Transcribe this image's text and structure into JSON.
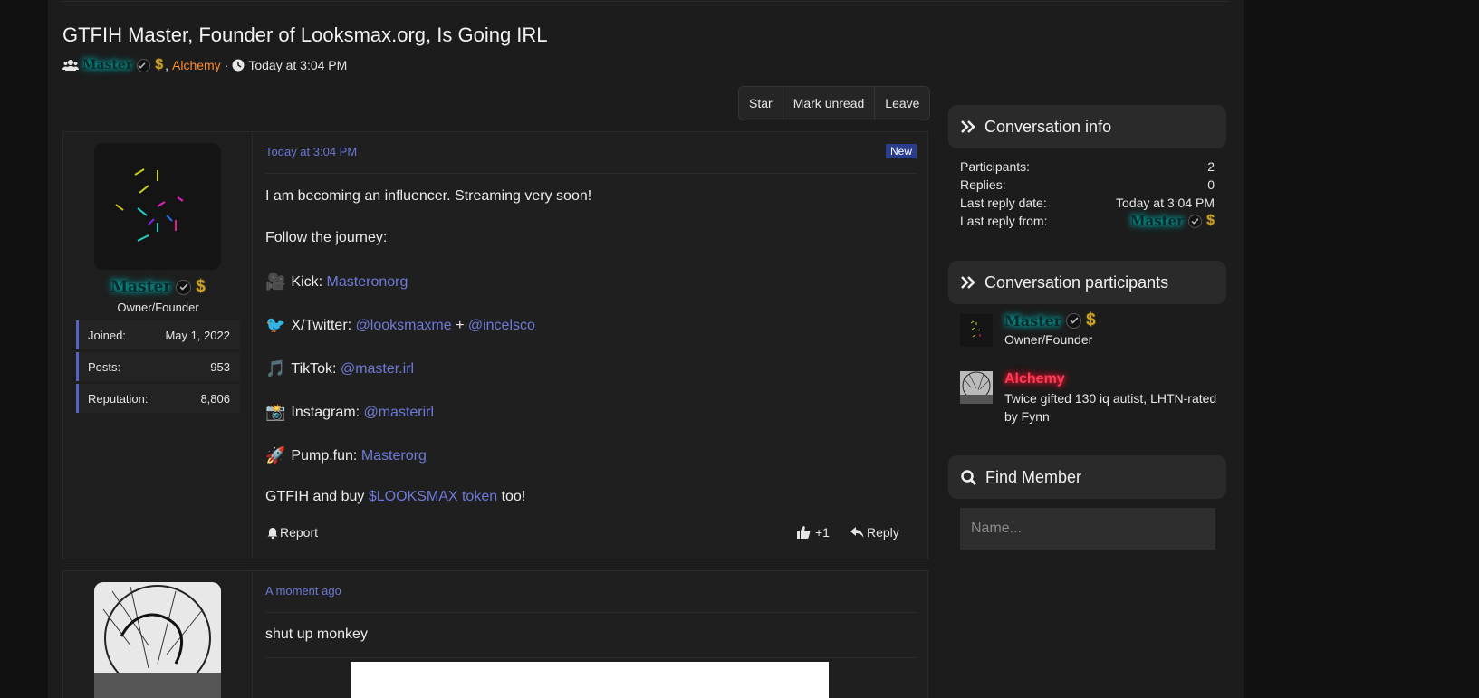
{
  "thread": {
    "title": "GTFIH Master, Founder of Looksmax.org, Is Going IRL",
    "participant_1": "Master",
    "separator": ",",
    "participant_2": "Alchemy",
    "dot": "·",
    "time": "Today at 3:04 PM"
  },
  "actions": {
    "star": "Star",
    "mark_unread": "Mark unread",
    "leave": "Leave"
  },
  "post1": {
    "time": "Today at 3:04 PM",
    "badge": "New",
    "author": "Master",
    "author_title": "Owner/Founder",
    "stats": [
      {
        "label": "Joined:",
        "value": "May 1, 2022"
      },
      {
        "label": "Posts:",
        "value": "953"
      },
      {
        "label": "Reputation:",
        "value": "8,806"
      }
    ],
    "line1": "I am becoming an influencer. Streaming very soon!",
    "line2": "Follow the journey:",
    "kick": {
      "emoji": "🎥",
      "label": "Kick:",
      "link": "Masteronorg"
    },
    "twitter": {
      "emoji": "🐦",
      "label": "X/Twitter:",
      "link1": "@looksmaxme",
      "plus": "+",
      "link2": "@incelsco"
    },
    "tiktok": {
      "emoji": "🎵",
      "label": "TikTok:",
      "link": "@master.irl"
    },
    "instagram": {
      "emoji": "📸",
      "label": "Instagram:",
      "link": "@masterirl"
    },
    "pump": {
      "emoji": "🚀",
      "label": "Pump.fun:",
      "link": "Masterorg"
    },
    "closing_pre": "GTFIH and buy",
    "closing_link": "$LOOKSMAX token",
    "closing_post": "too!",
    "report": "Report",
    "likes": "+1",
    "reply": "Reply"
  },
  "post2": {
    "time": "A moment ago",
    "text": "shut up monkey"
  },
  "sidebar": {
    "info_title": "Conversation info",
    "info_rows": [
      {
        "label": "Participants:",
        "value": "2"
      },
      {
        "label": "Replies:",
        "value": "0"
      },
      {
        "label": "Last reply date:",
        "value": "Today at 3:04 PM"
      },
      {
        "label": "Last reply from:",
        "value": "Master"
      }
    ],
    "participants_title": "Conversation participants",
    "participants": [
      {
        "name": "Master",
        "title": "Owner/Founder"
      },
      {
        "name": "Alchemy",
        "title": "Twice gifted 130 iq autist, LHTN-rated by Fynn"
      }
    ],
    "find_title": "Find Member",
    "find_placeholder": "Name..."
  },
  "colors": {
    "accent_link": "#6e7ad8",
    "badge": "#2a3d8a",
    "alchemy_orange": "#ff8c2a",
    "master_glow": "#00c8c8"
  },
  "icons": [
    "users-icon",
    "verified-icon",
    "dollar-icon",
    "clock-icon",
    "double-chevron-icon",
    "search-icon",
    "bell-icon",
    "thumbs-up-icon",
    "reply-icon"
  ]
}
